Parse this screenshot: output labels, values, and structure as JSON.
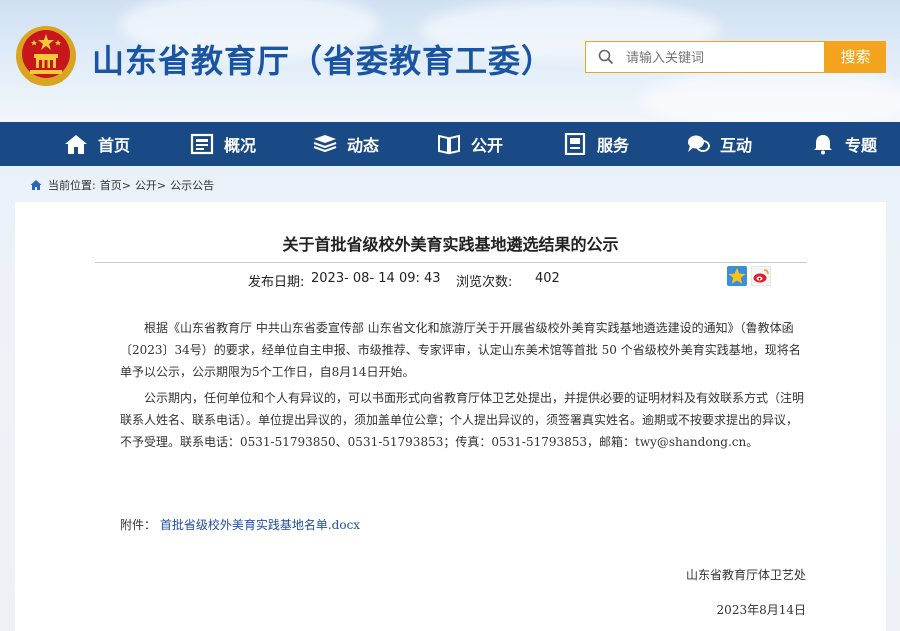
{
  "site": {
    "title": "山东省教育厅（省委教育工委）",
    "search_placeholder": "请输入关键词",
    "search_button": "搜索"
  },
  "nav": {
    "items": [
      {
        "label": "首页",
        "icon": "home-icon"
      },
      {
        "label": "概况",
        "icon": "overview-icon"
      },
      {
        "label": "动态",
        "icon": "news-stack-icon"
      },
      {
        "label": "公开",
        "icon": "book-open-icon"
      },
      {
        "label": "服务",
        "icon": "service-doc-icon"
      },
      {
        "label": "互动",
        "icon": "chat-bubble-icon"
      },
      {
        "label": "专题",
        "icon": "bell-icon"
      }
    ]
  },
  "breadcrumb": {
    "prefix": "当前位置:",
    "items": [
      "首页>",
      "公开>",
      "公示公告"
    ]
  },
  "article": {
    "title": "关于首批省级校外美育实践基地遴选结果的公示",
    "publish_label": "发布日期:",
    "publish_date": "2023- 08- 14 09: 43",
    "views_label": "浏览次数:",
    "views": "402",
    "paragraph1": "根据《山东省教育厅 中共山东省委宣传部 山东省文化和旅游厅关于开展省级校外美育实践基地遴选建设的通知》（鲁教体函〔2023〕34号）的要求，经单位自主申报、市级推荐、专家评审，认定山东美术馆等首批 50 个省级校外美育实践基地，现将名单予以公示，公示期限为5个工作日，自8月14日开始。",
    "paragraph2": "公示期内，任何单位和个人有异议的，可以书面形式向省教育厅体卫艺处提出，并提供必要的证明材料及有效联系方式（注明联系人姓名、联系电话）。单位提出异议的，须加盖单位公章；个人提出异议的，须签署真实姓名。逾期或不按要求提出的异议，不予受理。联系电话：0531-51793850、0531-51793853；传真：0531-51793853，邮箱：twy@shandong.cn。",
    "attachment_label": "附件：",
    "attachment_link": "首批省级校外美育实践基地名单.docx",
    "signature": "山东省教育厅体卫艺处",
    "sign_date": "2023年8月14日"
  },
  "colors": {
    "nav_bg": "#1a4a86",
    "title_blue": "#1a55a4",
    "search_btn": "#f4a41c",
    "link": "#1f4fa3"
  }
}
